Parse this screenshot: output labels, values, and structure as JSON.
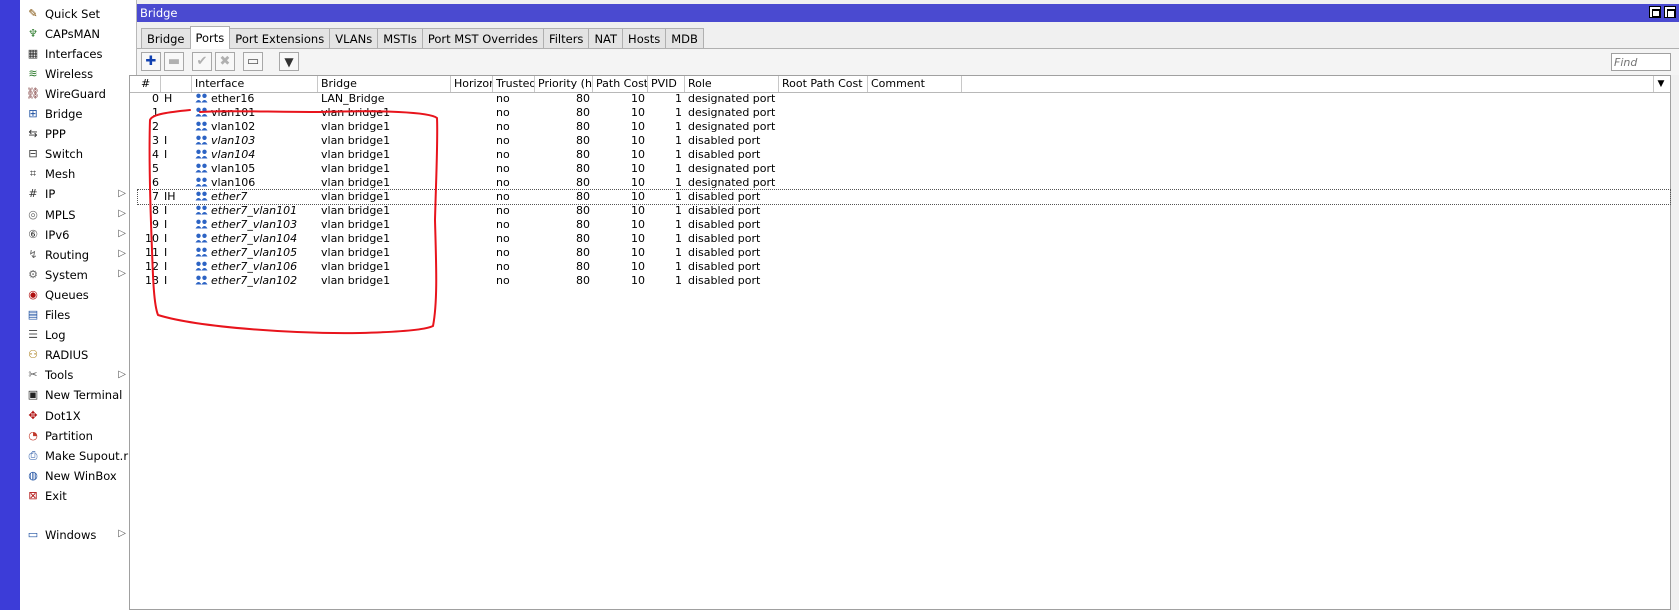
{
  "window": {
    "title": "Bridge",
    "accent_color": "#3c3cd8",
    "titlebar_color": "#4a4ad0"
  },
  "sidebar": {
    "items": [
      {
        "label": "Quick Set",
        "icon": "wand-icon",
        "submenu": false
      },
      {
        "label": "CAPsMAN",
        "icon": "antenna-icon",
        "submenu": false
      },
      {
        "label": "Interfaces",
        "icon": "interfaces-icon",
        "submenu": false
      },
      {
        "label": "Wireless",
        "icon": "wireless-icon",
        "submenu": false
      },
      {
        "label": "WireGuard",
        "icon": "wireguard-icon",
        "submenu": false
      },
      {
        "label": "Bridge",
        "icon": "bridge-icon",
        "submenu": false
      },
      {
        "label": "PPP",
        "icon": "ppp-icon",
        "submenu": false
      },
      {
        "label": "Switch",
        "icon": "switch-icon",
        "submenu": false
      },
      {
        "label": "Mesh",
        "icon": "mesh-icon",
        "submenu": false
      },
      {
        "label": "IP",
        "icon": "ip-icon",
        "submenu": true
      },
      {
        "label": "MPLS",
        "icon": "mpls-icon",
        "submenu": true
      },
      {
        "label": "IPv6",
        "icon": "ipv6-icon",
        "submenu": true
      },
      {
        "label": "Routing",
        "icon": "routing-icon",
        "submenu": true
      },
      {
        "label": "System",
        "icon": "gear-icon",
        "submenu": true
      },
      {
        "label": "Queues",
        "icon": "queues-icon",
        "submenu": false
      },
      {
        "label": "Files",
        "icon": "folder-icon",
        "submenu": false
      },
      {
        "label": "Log",
        "icon": "log-icon",
        "submenu": false
      },
      {
        "label": "RADIUS",
        "icon": "radius-icon",
        "submenu": false
      },
      {
        "label": "Tools",
        "icon": "tools-icon",
        "submenu": true
      },
      {
        "label": "New Terminal",
        "icon": "terminal-icon",
        "submenu": false
      },
      {
        "label": "Dot1X",
        "icon": "dot1x-icon",
        "submenu": false
      },
      {
        "label": "Partition",
        "icon": "partition-icon",
        "submenu": false
      },
      {
        "label": "Make Supout.rif",
        "icon": "supout-icon",
        "submenu": false
      },
      {
        "label": "New WinBox",
        "icon": "winbox-icon",
        "submenu": false
      },
      {
        "label": "Exit",
        "icon": "exit-icon",
        "submenu": false
      }
    ],
    "windows_item": {
      "label": "Windows",
      "icon": "windows-icon",
      "submenu": true
    }
  },
  "tabs": [
    {
      "label": "Bridge",
      "active": false
    },
    {
      "label": "Ports",
      "active": true
    },
    {
      "label": "Port Extensions",
      "active": false
    },
    {
      "label": "VLANs",
      "active": false
    },
    {
      "label": "MSTIs",
      "active": false
    },
    {
      "label": "Port MST Overrides",
      "active": false
    },
    {
      "label": "Filters",
      "active": false
    },
    {
      "label": "NAT",
      "active": false
    },
    {
      "label": "Hosts",
      "active": false
    },
    {
      "label": "MDB",
      "active": false
    }
  ],
  "toolbar": {
    "buttons": [
      {
        "name": "add-button",
        "glyph": "✚",
        "disabled": false
      },
      {
        "name": "remove-button",
        "glyph": "▬",
        "disabled": true
      },
      {
        "name": "enable-button",
        "glyph": "✔",
        "disabled": true
      },
      {
        "name": "disable-button",
        "glyph": "✖",
        "disabled": true
      },
      {
        "name": "comment-button",
        "glyph": "▭",
        "disabled": false
      },
      {
        "name": "filter-button",
        "glyph": "▼",
        "disabled": false
      }
    ],
    "find_placeholder": "Find"
  },
  "table": {
    "columns": [
      "#",
      "",
      "Interface",
      "Bridge",
      "Horizon",
      "Trusted",
      "Priority (h...",
      "Path Cost",
      "PVID",
      "Role",
      "Root Path Cost",
      "Comment"
    ],
    "rows": [
      {
        "num": "0",
        "flags": "H",
        "interface": "ether16",
        "bridge": "LAN_Bridge",
        "horizon": "",
        "trusted": "no",
        "priority": "80",
        "path_cost": "10",
        "pvid": "1",
        "role": "designated port",
        "root_path_cost": "",
        "comment": "",
        "inactive": false
      },
      {
        "num": "1",
        "flags": "",
        "interface": "vlan101",
        "bridge": "vlan bridge1",
        "horizon": "",
        "trusted": "no",
        "priority": "80",
        "path_cost": "10",
        "pvid": "1",
        "role": "designated port",
        "root_path_cost": "",
        "comment": "",
        "inactive": false
      },
      {
        "num": "2",
        "flags": "",
        "interface": "vlan102",
        "bridge": "vlan bridge1",
        "horizon": "",
        "trusted": "no",
        "priority": "80",
        "path_cost": "10",
        "pvid": "1",
        "role": "designated port",
        "root_path_cost": "",
        "comment": "",
        "inactive": false
      },
      {
        "num": "3",
        "flags": "I",
        "interface": "vlan103",
        "bridge": "vlan bridge1",
        "horizon": "",
        "trusted": "no",
        "priority": "80",
        "path_cost": "10",
        "pvid": "1",
        "role": "disabled port",
        "root_path_cost": "",
        "comment": "",
        "inactive": true
      },
      {
        "num": "4",
        "flags": "I",
        "interface": "vlan104",
        "bridge": "vlan bridge1",
        "horizon": "",
        "trusted": "no",
        "priority": "80",
        "path_cost": "10",
        "pvid": "1",
        "role": "disabled port",
        "root_path_cost": "",
        "comment": "",
        "inactive": true
      },
      {
        "num": "5",
        "flags": "",
        "interface": "vlan105",
        "bridge": "vlan bridge1",
        "horizon": "",
        "trusted": "no",
        "priority": "80",
        "path_cost": "10",
        "pvid": "1",
        "role": "designated port",
        "root_path_cost": "",
        "comment": "",
        "inactive": false
      },
      {
        "num": "6",
        "flags": "",
        "interface": "vlan106",
        "bridge": "vlan bridge1",
        "horizon": "",
        "trusted": "no",
        "priority": "80",
        "path_cost": "10",
        "pvid": "1",
        "role": "designated port",
        "root_path_cost": "",
        "comment": "",
        "inactive": false
      },
      {
        "num": "7",
        "flags": "IH",
        "interface": "ether7",
        "bridge": "vlan bridge1",
        "horizon": "",
        "trusted": "no",
        "priority": "80",
        "path_cost": "10",
        "pvid": "1",
        "role": "disabled port",
        "root_path_cost": "",
        "comment": "",
        "inactive": true,
        "selected": true
      },
      {
        "num": "8",
        "flags": "I",
        "interface": "ether7_vlan101",
        "bridge": "vlan bridge1",
        "horizon": "",
        "trusted": "no",
        "priority": "80",
        "path_cost": "10",
        "pvid": "1",
        "role": "disabled port",
        "root_path_cost": "",
        "comment": "",
        "inactive": true
      },
      {
        "num": "9",
        "flags": "I",
        "interface": "ether7_vlan103",
        "bridge": "vlan bridge1",
        "horizon": "",
        "trusted": "no",
        "priority": "80",
        "path_cost": "10",
        "pvid": "1",
        "role": "disabled port",
        "root_path_cost": "",
        "comment": "",
        "inactive": true
      },
      {
        "num": "10",
        "flags": "I",
        "interface": "ether7_vlan104",
        "bridge": "vlan bridge1",
        "horizon": "",
        "trusted": "no",
        "priority": "80",
        "path_cost": "10",
        "pvid": "1",
        "role": "disabled port",
        "root_path_cost": "",
        "comment": "",
        "inactive": true
      },
      {
        "num": "11",
        "flags": "I",
        "interface": "ether7_vlan105",
        "bridge": "vlan bridge1",
        "horizon": "",
        "trusted": "no",
        "priority": "80",
        "path_cost": "10",
        "pvid": "1",
        "role": "disabled port",
        "root_path_cost": "",
        "comment": "",
        "inactive": true
      },
      {
        "num": "12",
        "flags": "I",
        "interface": "ether7_vlan106",
        "bridge": "vlan bridge1",
        "horizon": "",
        "trusted": "no",
        "priority": "80",
        "path_cost": "10",
        "pvid": "1",
        "role": "disabled port",
        "root_path_cost": "",
        "comment": "",
        "inactive": true
      },
      {
        "num": "13",
        "flags": "I",
        "interface": "ether7_vlan102",
        "bridge": "vlan bridge1",
        "horizon": "",
        "trusted": "no",
        "priority": "80",
        "path_cost": "10",
        "pvid": "1",
        "role": "disabled port",
        "root_path_cost": "",
        "comment": "",
        "inactive": true
      }
    ]
  },
  "annotation": {
    "color": "#e8141c"
  }
}
